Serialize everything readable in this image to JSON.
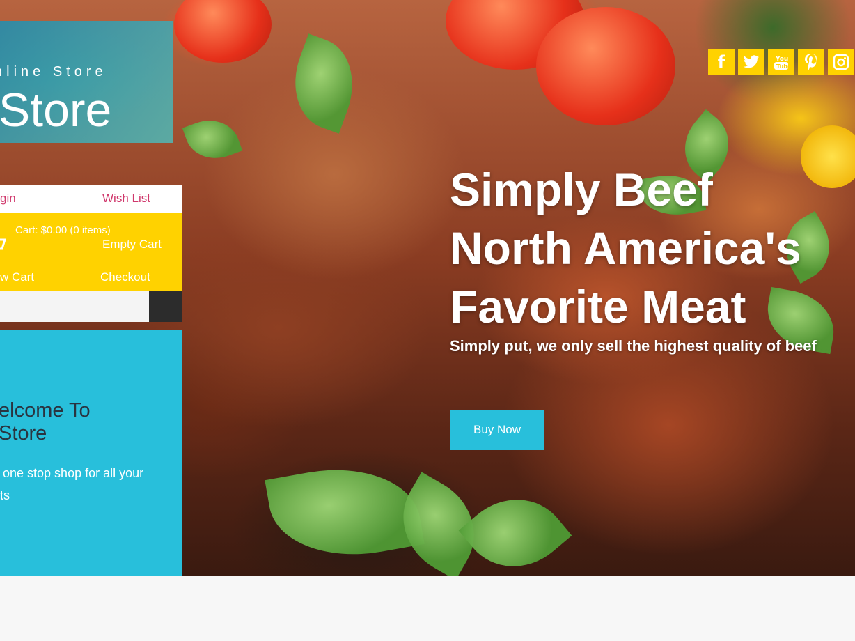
{
  "brand": {
    "tagline": "nline Store",
    "name": "uStore"
  },
  "social": [
    {
      "icon": "facebook-icon",
      "glyph": "f"
    },
    {
      "icon": "twitter-icon",
      "glyph": ""
    },
    {
      "icon": "youtube-icon",
      "glyph": ""
    },
    {
      "icon": "pinterest-icon",
      "glyph": ""
    },
    {
      "icon": "instagram-icon",
      "glyph": ""
    }
  ],
  "account": {
    "login_label": "gin",
    "wishlist_label": "Wish List"
  },
  "cart": {
    "summary": "Cart: $0.00 (0 items)",
    "empty_label": "Empty Cart",
    "view_label": "w Cart",
    "checkout_label": "Checkout"
  },
  "search": {
    "placeholder": ""
  },
  "welcome": {
    "title_line1": "elcome To",
    "title_line2": "Store",
    "text_line1": "one stop shop for all your",
    "text_line2": "ts"
  },
  "hero": {
    "line1": "Simply Beef",
    "line2": "North America's",
    "line3": "Favorite Meat",
    "subtitle": "Simply put, we only sell the highest quality of beef",
    "button_label": "Buy Now"
  },
  "colors": {
    "accent_yellow": "#ffd200",
    "accent_cyan": "#28bfdb",
    "link_pink": "#d0386c",
    "dark": "#2c2c2c"
  }
}
